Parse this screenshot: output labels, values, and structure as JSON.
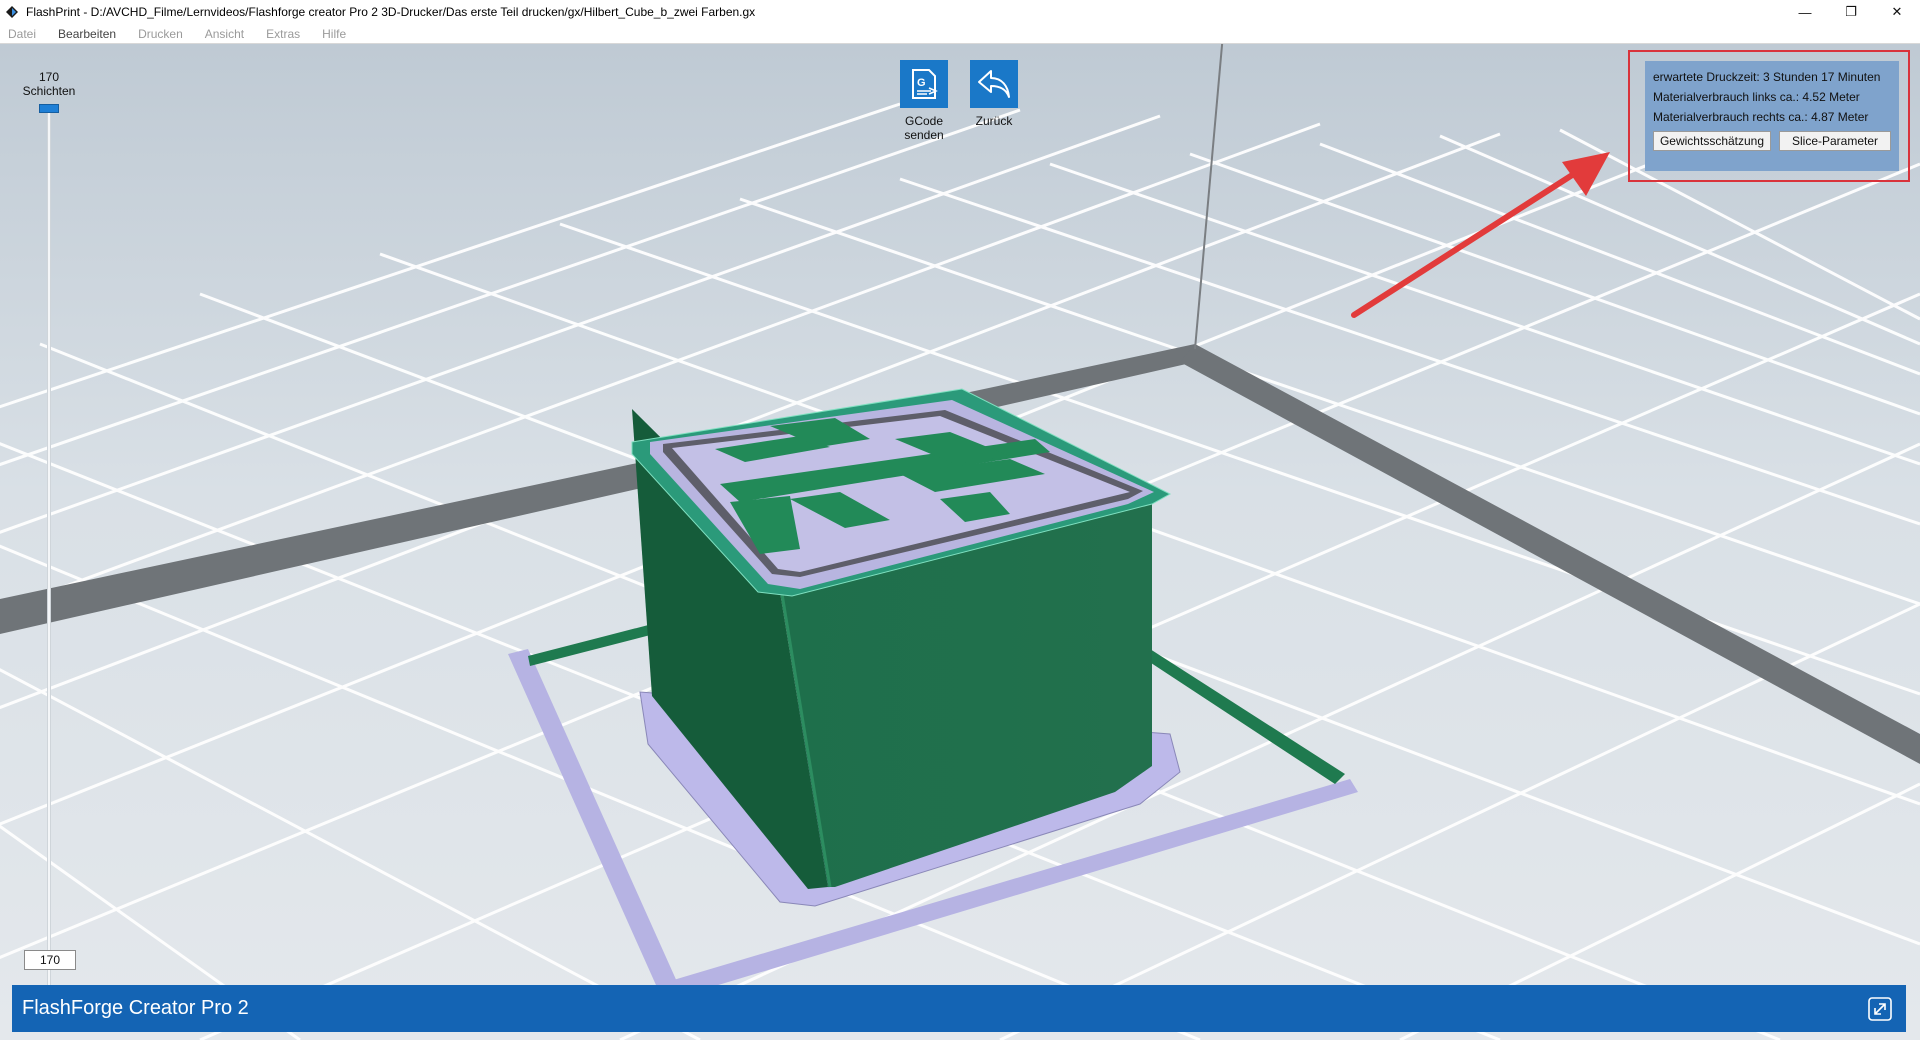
{
  "window": {
    "title": "FlashPrint - D:/AVCHD_Filme/Lernvideos/Flashforge creator Pro 2 3D-Drucker/Das erste Teil drucken/gx/Hilbert_Cube_b_zwei Farben.gx",
    "minimize_glyph": "—",
    "maximize_glyph": "❐",
    "close_glyph": "✕"
  },
  "menu": {
    "items": [
      {
        "label": "Datei"
      },
      {
        "label": "Bearbeiten"
      },
      {
        "label": "Drucken"
      },
      {
        "label": "Ansicht"
      },
      {
        "label": "Extras"
      },
      {
        "label": "Hilfe"
      }
    ]
  },
  "layer_slider": {
    "top_count": "170",
    "top_unit": "Schichten",
    "current_value": "170"
  },
  "toolbar": {
    "send_gcode_line1": "GCode",
    "send_gcode_line2": "senden",
    "send_gcode_icon": "gcode-send-icon",
    "back_label": "Zurück",
    "back_icon": "undo-arrow-icon"
  },
  "print_info": {
    "estimated_time": "erwartete Druckzeit: 3 Stunden 17 Minuten",
    "material_left": "Materialverbrauch links ca.: 4.52 Meter",
    "material_right": "Materialverbrauch rechts ca.: 4.87 Meter",
    "weight_button": "Gewichtsschätzung",
    "slice_button": "Slice-Parameter"
  },
  "status_bar": {
    "printer_name": "FlashForge Creator Pro 2",
    "expand_icon": "expand-icon"
  },
  "colors": {
    "accent_blue": "#1464b4",
    "tile_blue": "#1a78c8",
    "model_green": "#1f7a4f",
    "support_lavender": "#b7b4e2",
    "highlight_red": "#d9333b"
  }
}
